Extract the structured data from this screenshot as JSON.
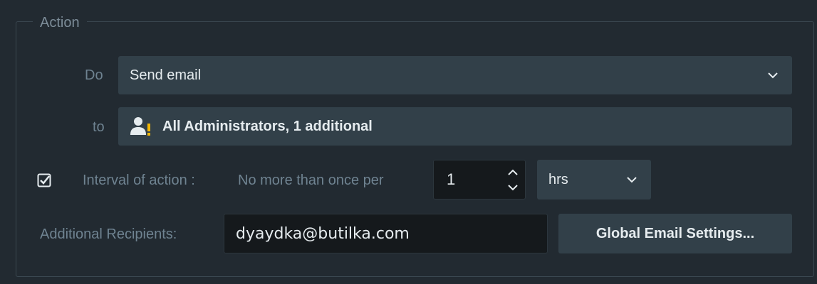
{
  "group": {
    "title": "Action"
  },
  "do_row": {
    "label": "Do",
    "value": "Send email",
    "icon": "chevron-down-icon"
  },
  "to_row": {
    "label": "to",
    "value": "All Administrators, 1 additional",
    "icon": "users-warning-icon"
  },
  "interval_row": {
    "checked": true,
    "label": "Interval of action :",
    "prefix": "No more than once per",
    "value": "1",
    "unit": "hrs"
  },
  "recipients_row": {
    "label": "Additional Recipients:",
    "value": "dyaydka@butilka.com",
    "button_label": "Global Email Settings..."
  },
  "colors": {
    "background": "#222a31",
    "field": "#324049",
    "input": "#15191c",
    "label": "#6f8391",
    "text": "#e6ecef",
    "warning": "#f2b705"
  }
}
